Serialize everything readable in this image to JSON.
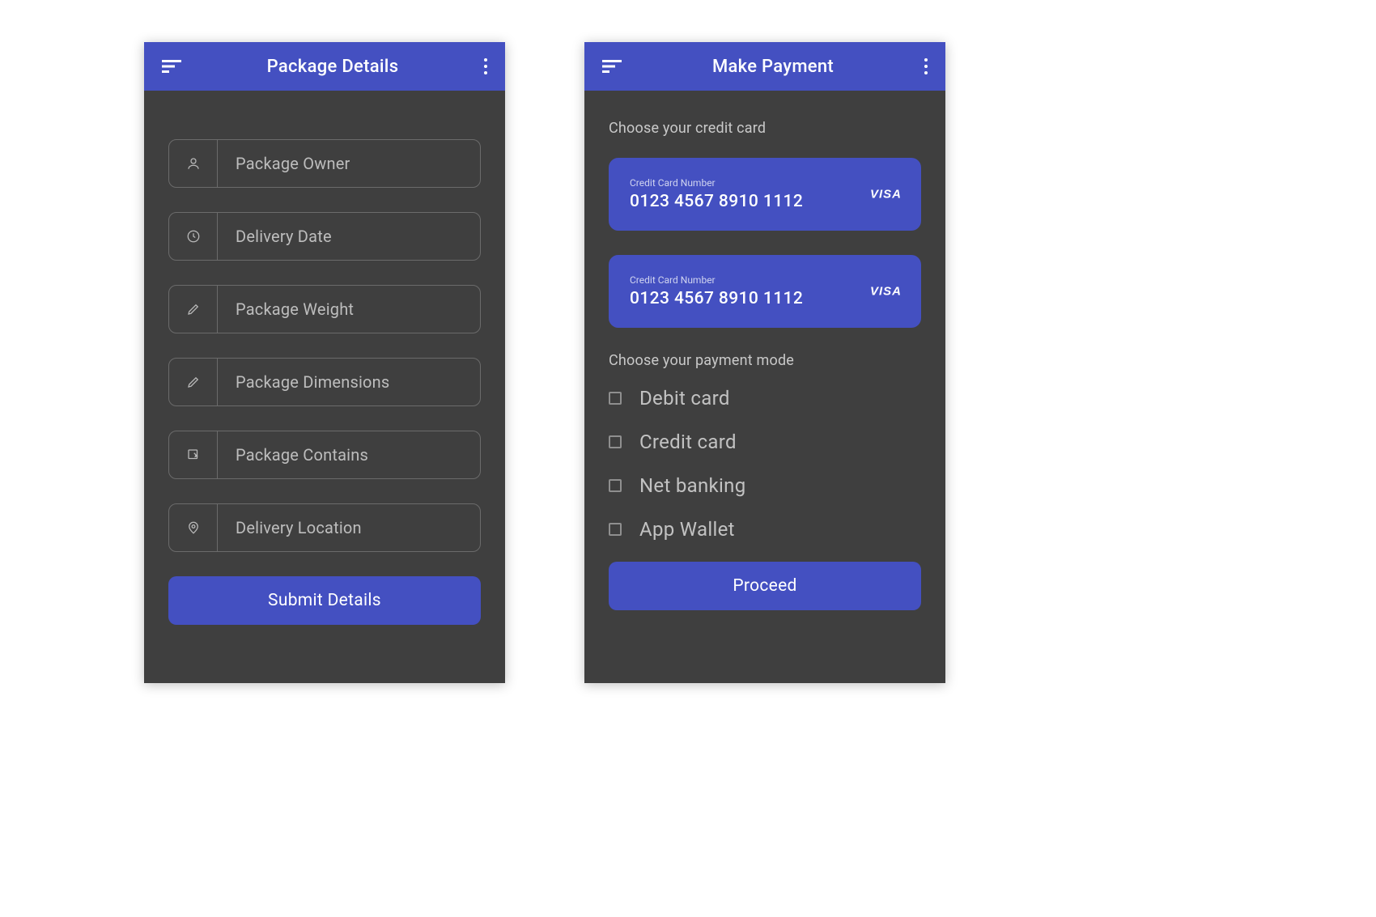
{
  "screens": {
    "left": {
      "appbar_title": "Package Details",
      "fields": [
        {
          "placeholder": "Package Owner"
        },
        {
          "placeholder": "Delivery Date"
        },
        {
          "placeholder": "Package Weight"
        },
        {
          "placeholder": "Package Dimensions"
        },
        {
          "placeholder": "Package Contains"
        },
        {
          "placeholder": "Delivery Location"
        }
      ],
      "submit_label": "Submit Details"
    },
    "right": {
      "appbar_title": "Make Payment",
      "choose_card_label": "Choose your credit card",
      "cards": [
        {
          "cc_label": "Credit Card Number",
          "cc_number": "0123 4567 8910 1112",
          "brand": "VISA"
        },
        {
          "cc_label": "Credit Card Number",
          "cc_number": "0123 4567 8910 1112",
          "brand": "VISA"
        }
      ],
      "choose_mode_label": "Choose your payment mode",
      "modes": [
        {
          "label": "Debit card"
        },
        {
          "label": "Credit card"
        },
        {
          "label": "Net banking"
        },
        {
          "label": "App Wallet"
        }
      ],
      "proceed_label": "Proceed"
    }
  },
  "colors": {
    "accent": "#4450c1",
    "surface": "#3f3f3f",
    "text_muted": "#bdbdbd"
  }
}
